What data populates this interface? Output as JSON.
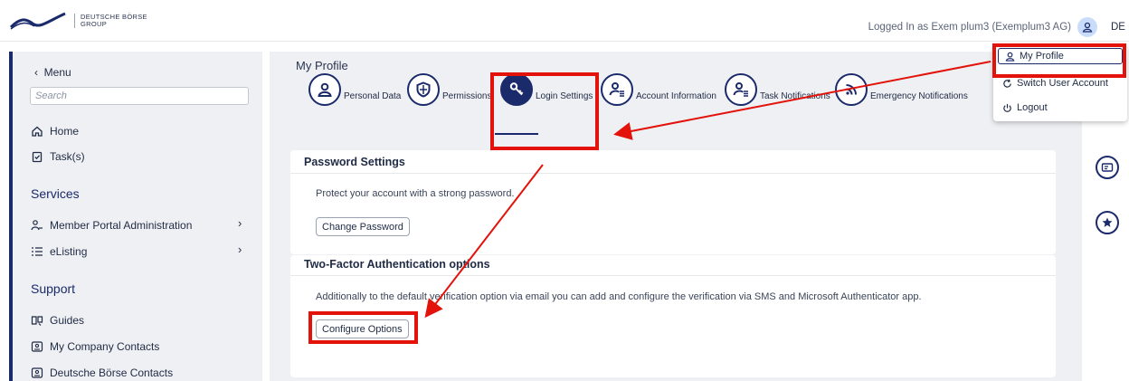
{
  "header": {
    "brand_line1": "DEUTSCHE BÖRSE",
    "brand_line2": "GROUP",
    "login_text": "Logged In as Exem plum3 (Exemplum3 AG)",
    "language": "DE",
    "user_icon": "user-icon"
  },
  "sidebar": {
    "menu_label": "Menu",
    "search_placeholder": "Search",
    "items": [
      {
        "label": "Home",
        "icon": "home-icon"
      },
      {
        "label": "Task(s)",
        "icon": "clipboard-check-icon"
      }
    ],
    "services_title": "Services",
    "services": [
      {
        "label": "Member Portal Administration",
        "icon": "users-icon",
        "has_submenu": true
      },
      {
        "label": "eListing",
        "icon": "list-icon",
        "has_submenu": true
      }
    ],
    "support_title": "Support",
    "support": [
      {
        "label": "Guides",
        "icon": "book-icon"
      },
      {
        "label": "My Company Contacts",
        "icon": "contact-card-icon"
      },
      {
        "label": "Deutsche Börse Contacts",
        "icon": "contact-card-icon"
      }
    ]
  },
  "main": {
    "page_title": "My Profile",
    "tabs": [
      {
        "label": "Personal Data",
        "icon": "user-icon"
      },
      {
        "label": "Permissions",
        "icon": "shield-icon"
      },
      {
        "label": "Login Settings",
        "icon": "key-icon",
        "active": true
      },
      {
        "label": "Account Information",
        "icon": "user-list-icon"
      },
      {
        "label": "Task Notifications",
        "icon": "user-list-icon"
      },
      {
        "label": "Emergency Notifications",
        "icon": "broadcast-icon"
      }
    ],
    "password": {
      "title": "Password Settings",
      "text": "Protect your account with a strong password.",
      "button": "Change Password"
    },
    "twofa": {
      "title": "Two-Factor Authentication options",
      "text": "Additionally to the default verification option via email you can add and configure the verification via SMS and Microsoft Authenticator app.",
      "button": "Configure Options"
    }
  },
  "user_menu": {
    "items": [
      {
        "label": "My Profile",
        "icon": "user-icon"
      },
      {
        "label": "Switch User Account",
        "icon": "switch-icon"
      },
      {
        "label": "Logout",
        "icon": "power-icon"
      }
    ]
  },
  "rail": {
    "icons": [
      "contact-card-icon",
      "star-icon"
    ]
  },
  "colors": {
    "brand": "#1b2a6b",
    "highlight": "#e3120b",
    "panel_bg": "#eef0f3"
  }
}
